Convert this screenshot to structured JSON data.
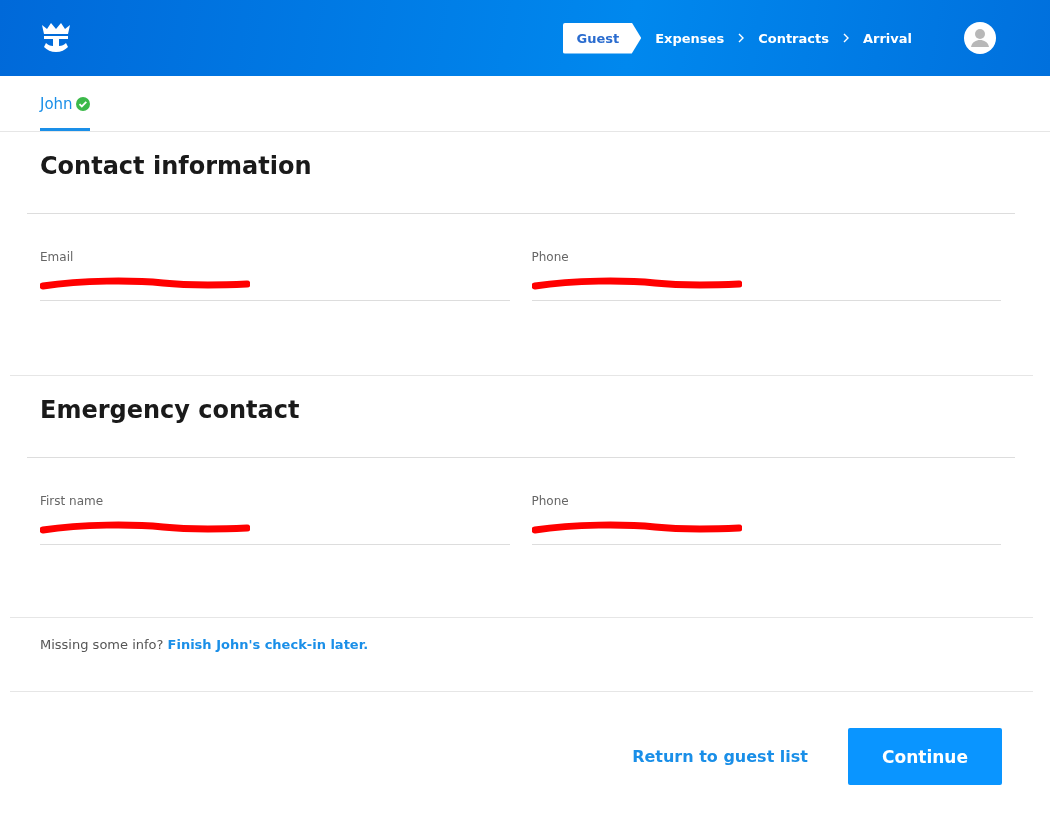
{
  "header": {
    "steps": [
      {
        "label": "Guest",
        "selected": true
      },
      {
        "label": "Expenses",
        "selected": false
      },
      {
        "label": "Contracts",
        "selected": false
      },
      {
        "label": "Arrival",
        "selected": false
      }
    ]
  },
  "tabs": [
    {
      "label": "John",
      "selected": true,
      "complete": true
    }
  ],
  "sections": [
    {
      "title": "Contact information",
      "fields": [
        {
          "label": "Email",
          "redacted": true
        },
        {
          "label": "Phone",
          "redacted": true
        }
      ]
    },
    {
      "title": "Emergency contact",
      "fields": [
        {
          "label": "First name",
          "redacted": true
        },
        {
          "label": "Phone",
          "redacted": true
        }
      ]
    }
  ],
  "note": {
    "text": "Missing some info?",
    "link": "Finish John's check-in later."
  },
  "actions": {
    "secondary": "Return to guest list",
    "primary": "Continue"
  }
}
